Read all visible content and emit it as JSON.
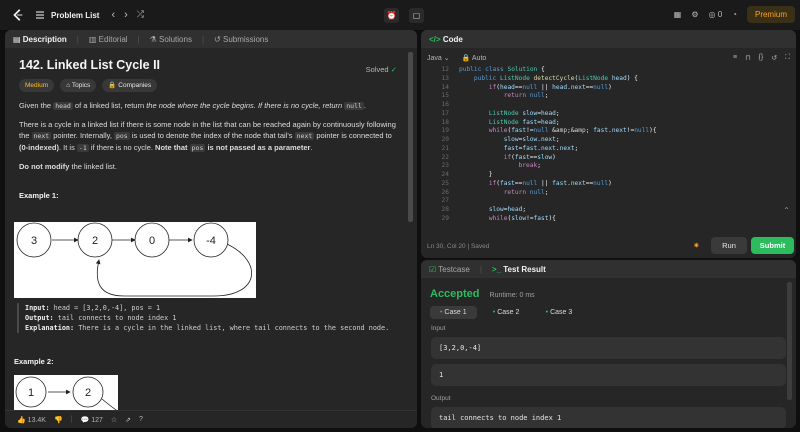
{
  "topbar": {
    "problem_list": "Problem List",
    "streak": "0",
    "premium": "Premium"
  },
  "left": {
    "tabs": [
      "Description",
      "Editorial",
      "Solutions",
      "Submissions"
    ],
    "title": "142. Linked List Cycle II",
    "solved": "Solved",
    "badges": [
      "Medium",
      "Topics",
      "Companies"
    ],
    "p1": [
      "Given the ",
      "head",
      " of a linked list, return ",
      "the node where the cycle begins. If there is no cycle, return ",
      "null",
      "."
    ],
    "p2": [
      "There is a cycle in a linked list if there is some node in the list that can be reached again by continuously following the ",
      "next",
      " pointer. Internally, ",
      "pos",
      " is used to denote the index of the node that tail's ",
      "next",
      " pointer is connected to ",
      "(0-indexed)",
      ". It is ",
      "-1",
      " if there is no cycle. ",
      "Note that ",
      "pos",
      " is not passed as a parameter",
      "."
    ],
    "p3": [
      "Do not modify",
      " the linked list."
    ],
    "example1": "Example 1:",
    "ex1_nodes": [
      "3",
      "2",
      "0",
      "-4"
    ],
    "ex1_input_label": "Input:",
    "ex1_input": "head = [3,2,0,-4], pos = 1",
    "ex1_output_label": "Output:",
    "ex1_output": "tail connects to node index 1",
    "ex1_expl_label": "Explanation:",
    "ex1_expl": "There is a cycle in the linked list, where tail connects to the second node.",
    "example2": "Example 2:",
    "ex2_nodes": [
      "1",
      "2"
    ],
    "likes": "13.4K",
    "comments": "127"
  },
  "code": {
    "tab": "Code",
    "lang": "Java",
    "auto": "Auto",
    "status": "Ln 30, Col 20  |  Saved",
    "run": "Run",
    "submit": "Submit",
    "lines": [
      {
        "n": "12",
        "t": "public class Solution {"
      },
      {
        "n": "13",
        "t": "    public ListNode detectCycle(ListNode head) {"
      },
      {
        "n": "14",
        "t": "        if(head==null || head.next==null)"
      },
      {
        "n": "15",
        "t": "            return null;"
      },
      {
        "n": "16",
        "t": ""
      },
      {
        "n": "17",
        "t": "        ListNode slow=head;"
      },
      {
        "n": "18",
        "t": "        ListNode fast=head;"
      },
      {
        "n": "19",
        "t": "        while(fast!=null && fast.next!=null){"
      },
      {
        "n": "20",
        "t": "            slow=slow.next;"
      },
      {
        "n": "21",
        "t": "            fast=fast.next.next;"
      },
      {
        "n": "22",
        "t": "            if(fast==slow)"
      },
      {
        "n": "23",
        "t": "                break;"
      },
      {
        "n": "24",
        "t": "        }"
      },
      {
        "n": "25",
        "t": "        if(fast==null || fast.next==null)"
      },
      {
        "n": "26",
        "t": "            return null;"
      },
      {
        "n": "27",
        "t": ""
      },
      {
        "n": "28",
        "t": "        slow=head;"
      },
      {
        "n": "29",
        "t": "        while(slow!=fast){"
      }
    ]
  },
  "result": {
    "tabs": [
      "Testcase",
      "Test Result"
    ],
    "accepted": "Accepted",
    "runtime": "Runtime: 0 ms",
    "cases": [
      "Case 1",
      "Case 2",
      "Case 3"
    ],
    "input_label": "Input",
    "input1": "[3,2,0,-4]",
    "input2": "1",
    "output_label": "Output",
    "output": "tail connects to node index 1"
  },
  "colors": {
    "accent": "#ffa116",
    "green": "#2cbb5d",
    "medium": "#ffc01e"
  }
}
